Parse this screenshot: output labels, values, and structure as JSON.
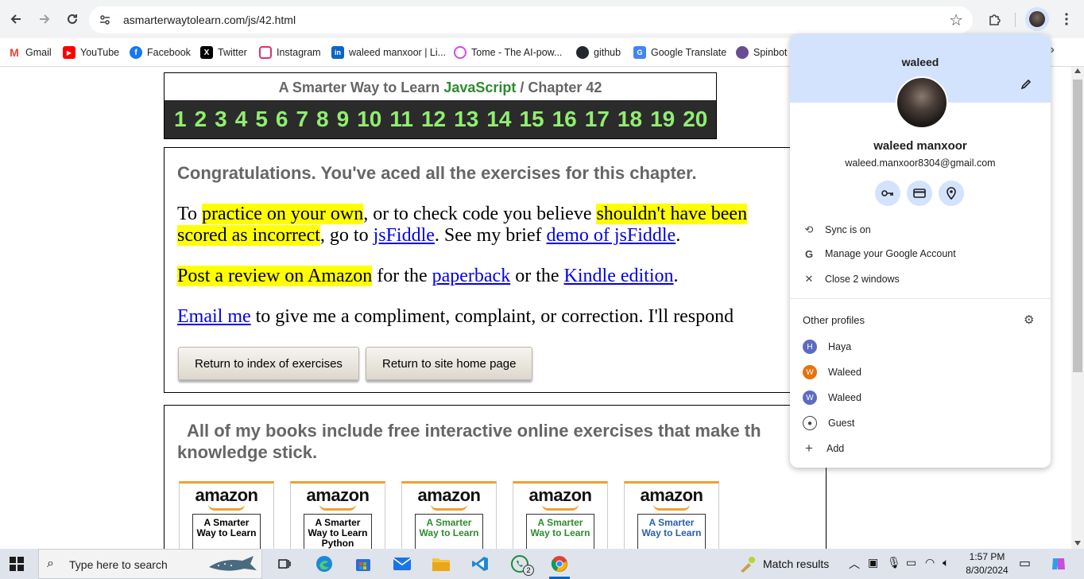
{
  "browser": {
    "url": "asmarterwaytolearn.com/js/42.html",
    "bookmarks": [
      {
        "label": "Gmail",
        "icon": "gmail-icon",
        "color": "#ea4335"
      },
      {
        "label": "YouTube",
        "icon": "youtube-icon",
        "color": "#ff0000"
      },
      {
        "label": "Facebook",
        "icon": "facebook-icon",
        "color": "#1877f2"
      },
      {
        "label": "Twitter",
        "icon": "x-twitter-icon",
        "color": "#000000"
      },
      {
        "label": "Instagram",
        "icon": "instagram-icon",
        "color": "#e1306c"
      },
      {
        "label": "waleed manxoor | Li...",
        "icon": "linkedin-icon",
        "color": "#0a66c2"
      },
      {
        "label": "Tome - The AI-pow...",
        "icon": "tome-icon",
        "color": "#d946ef"
      },
      {
        "label": "github",
        "icon": "github-icon",
        "color": "#24292f"
      },
      {
        "label": "Google Translate",
        "icon": "google-translate-icon",
        "color": "#4285f4"
      },
      {
        "label": "Spinbot",
        "icon": "spinbot-icon",
        "color": "#6a4c93"
      }
    ]
  },
  "page": {
    "header_prefix": "A Smarter Way to Learn",
    "header_js": "JavaScript",
    "header_suffix": "/  Chapter 42",
    "chapters": [
      "1",
      "2",
      "3",
      "4",
      "5",
      "6",
      "7",
      "8",
      "9",
      "10",
      "11",
      "12",
      "13",
      "14",
      "15",
      "16",
      "17",
      "18",
      "19",
      "20"
    ],
    "congrats": "Congratulations. You've aced all the exercises for this chapter.",
    "p1": {
      "t1": "To ",
      "h1": "practice on your own",
      "t2": ", or to check code you believe ",
      "h2": "shouldn't have been",
      "h3": "scored as incorrect",
      "t3": ", go to ",
      "l1": "jsFiddle",
      "t4": ". See my brief ",
      "l2": "demo of jsFiddle",
      "t5": "."
    },
    "p2": {
      "h1": "Post a review on Amazon",
      "t1": " for the ",
      "l1": "paperback",
      "t2": " or the ",
      "l2": "Kindle edition",
      "t3": "."
    },
    "p3": {
      "l1": "Email me",
      "t1": " to give me a compliment, complaint, or correction. I'll respond"
    },
    "btn_index": "Return to index of exercises",
    "btn_home": "Return to site home page",
    "books_line1": "All of my books include free interactive online exercises that make th",
    "books_line2": "knowledge stick.",
    "books": [
      {
        "brand": "amazon",
        "title": "A Smarter Way to Learn",
        "color": "#000000"
      },
      {
        "brand": "amazon",
        "title": "A Smarter Way to Learn Python",
        "color": "#000000"
      },
      {
        "brand": "amazon",
        "title": "A Smarter Way to Learn",
        "color": "#2e8b2e"
      },
      {
        "brand": "amazon",
        "title": "A Smarter Way to Learn",
        "color": "#2e8b2e"
      },
      {
        "brand": "amazon",
        "title": "A Smarter Way to Learn",
        "color": "#2a5db0"
      }
    ]
  },
  "profile": {
    "name": "waleed",
    "full_name": "waleed manxoor",
    "email": "waleed.manxoor8304@gmail.com",
    "sync": "Sync is on",
    "manage": "Manage your Google Account",
    "close": "Close 2 windows",
    "other_title": "Other profiles",
    "others": [
      {
        "label": "Haya",
        "initial": "H",
        "color": "#5c6bc0"
      },
      {
        "label": "Waleed",
        "initial": "W",
        "color": "#e8710a"
      },
      {
        "label": "Waleed",
        "initial": "W",
        "color": "#5c6bc0"
      }
    ],
    "guest": "Guest",
    "add": "Add"
  },
  "taskbar": {
    "search_placeholder": "Type here to search",
    "match_results": "Match results",
    "time": "1:57 PM",
    "date": "8/30/2024",
    "whatsapp_badge": "2"
  }
}
